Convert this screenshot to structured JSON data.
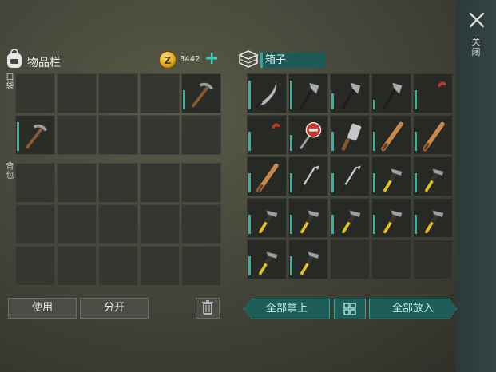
{
  "inventory": {
    "title": "物品栏",
    "coin_symbol": "Z",
    "coin_count": "3442",
    "add_coins_label": "+",
    "pocket_label": "口袋",
    "backpack_label": "背包",
    "pocket_slots": [
      {
        "item": "empty"
      },
      {
        "item": "empty"
      },
      {
        "item": "empty"
      },
      {
        "item": "empty"
      },
      {
        "item": "pickaxe",
        "durability": 0.6
      },
      {
        "item": "pickaxe",
        "durability": 0.9
      },
      {
        "item": "empty"
      },
      {
        "item": "empty"
      },
      {
        "item": "empty"
      },
      {
        "item": "empty"
      }
    ],
    "backpack_slots": [
      {
        "item": "empty"
      },
      {
        "item": "empty"
      },
      {
        "item": "empty"
      },
      {
        "item": "empty"
      },
      {
        "item": "empty"
      },
      {
        "item": "empty"
      },
      {
        "item": "empty"
      },
      {
        "item": "empty"
      },
      {
        "item": "empty"
      },
      {
        "item": "empty"
      },
      {
        "item": "empty"
      },
      {
        "item": "empty"
      },
      {
        "item": "empty"
      },
      {
        "item": "empty"
      },
      {
        "item": "empty"
      }
    ],
    "use_label": "使用",
    "split_label": "分开"
  },
  "chest": {
    "title": "箱子",
    "take_all_label": "全部拿上",
    "put_all_label": "全部放入",
    "slots": [
      {
        "item": "machete",
        "durability": 0.9
      },
      {
        "item": "hatchet",
        "durability": 0.9
      },
      {
        "item": "hatchet",
        "durability": 0.5
      },
      {
        "item": "hatchet",
        "durability": 0.3
      },
      {
        "item": "crowbar",
        "durability": 0.6
      },
      {
        "item": "crowbar",
        "durability": 0.6
      },
      {
        "item": "stop-sign",
        "durability": 0.5
      },
      {
        "item": "cleaver",
        "durability": 0.6
      },
      {
        "item": "bat",
        "durability": 0.6
      },
      {
        "item": "bat",
        "durability": 0.6
      },
      {
        "item": "bat",
        "durability": 0.6
      },
      {
        "item": "golf-club",
        "durability": 0.6
      },
      {
        "item": "golf-club",
        "durability": 0.6
      },
      {
        "item": "hammer",
        "durability": 0.6
      },
      {
        "item": "hammer",
        "durability": 0.6
      },
      {
        "item": "hammer",
        "durability": 0.6
      },
      {
        "item": "hammer",
        "durability": 0.6
      },
      {
        "item": "hammer",
        "durability": 0.6
      },
      {
        "item": "hammer",
        "durability": 0.6
      },
      {
        "item": "hammer",
        "durability": 0.6
      },
      {
        "item": "hammer",
        "durability": 0.6
      },
      {
        "item": "hammer",
        "durability": 0.6
      },
      {
        "item": "empty"
      },
      {
        "item": "empty"
      },
      {
        "item": "empty"
      }
    ]
  },
  "close_label": "关闭",
  "icons": {
    "close": "close-icon",
    "backpack": "backpack-icon",
    "coin": "coin-icon",
    "chest": "chest-icon",
    "trash": "trash-icon",
    "sort": "sort-grid-icon"
  },
  "colors": {
    "accent": "#2bb8a0",
    "button_teal": "#1f5e58",
    "box_name_bg": "#1e5a55"
  }
}
